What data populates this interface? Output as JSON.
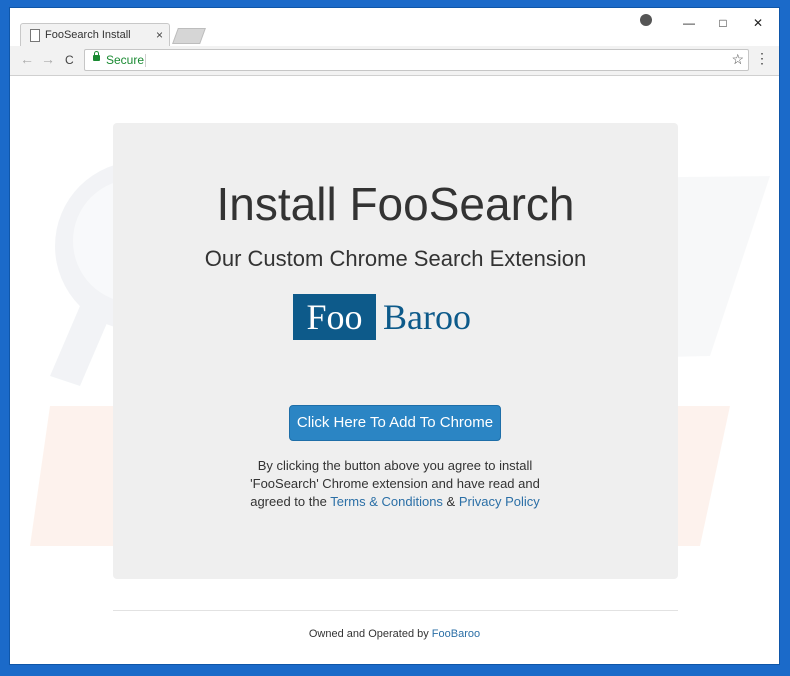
{
  "browser": {
    "tab_title": "FooSearch Install",
    "tab_close": "×",
    "window_controls": {
      "minimize": "—",
      "maximize": "□",
      "close": "✕"
    },
    "nav": {
      "back": "←",
      "forward": "→",
      "reload": "C"
    },
    "address": {
      "secure_label": "Secure",
      "value": ""
    },
    "bookmark_star": "☆",
    "menu": "⋮"
  },
  "page": {
    "title": "Install FooSearch",
    "subtitle": "Our Custom Chrome Search Extension",
    "logo": {
      "left": "Foo",
      "right": "Baroo",
      "color": "#0d5a8a"
    },
    "cta_button": "Click Here To Add To Chrome",
    "agree_text_1": "By clicking the button above you agree to install",
    "agree_text_2": "'FooSearch' Chrome extension and have read and",
    "agree_text_3_pre": "agreed to the ",
    "terms_link": "Terms & Conditions",
    "agree_amp": " & ",
    "privacy_link": "Privacy Policy",
    "footer_pre": "Owned and Operated by ",
    "footer_link": "FooBaroo"
  },
  "colors": {
    "frame": "#1b6ac9",
    "button": "#2b85c4",
    "link": "#2b6fa6",
    "panel": "#efefef"
  }
}
